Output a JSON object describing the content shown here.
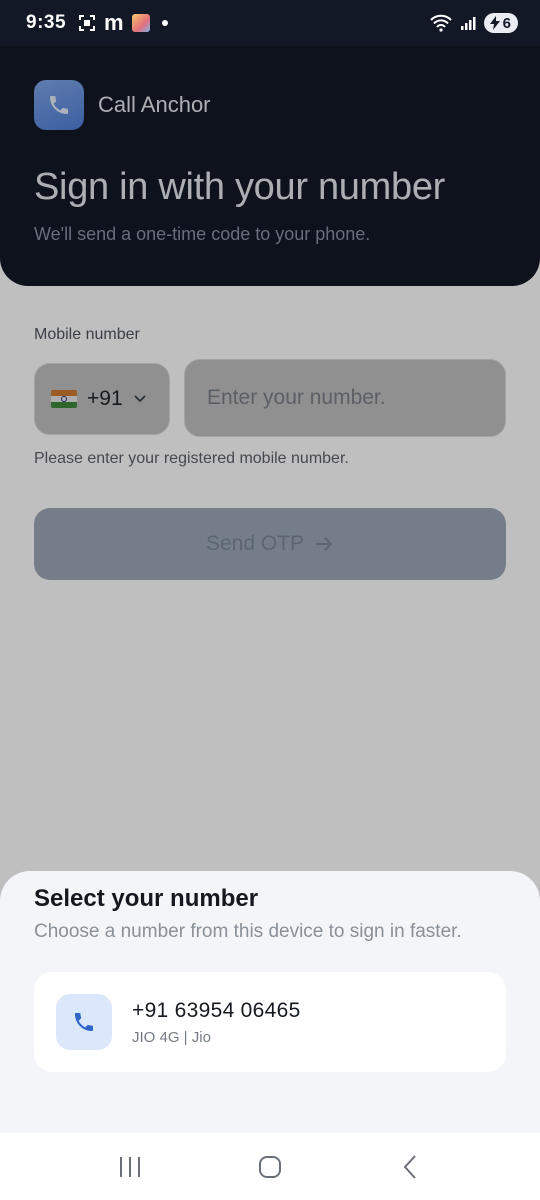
{
  "status_bar": {
    "time": "9:35",
    "left_icons": [
      "screenshot-icon",
      "m-app-icon",
      "app-thumbnail-icon",
      "notification-dot-icon"
    ],
    "m_glyph": "m",
    "right_icons": [
      "wifi-icon",
      "signal-icon",
      "battery-icon"
    ],
    "battery_level": "6"
  },
  "header": {
    "app_name": "Call Anchor",
    "title": "Sign in with your number",
    "subtitle": "We'll send a one-time code to your phone."
  },
  "form": {
    "mobile_label": "Mobile number",
    "country_code": "+91",
    "phone_placeholder": "Enter your number.",
    "helper_text": "Please enter your registered mobile number.",
    "send_otp_label": "Send OTP"
  },
  "sheet": {
    "title": "Select your number",
    "subtitle": "Choose a number from this device to sign in faster.",
    "numbers": [
      {
        "number": "+91 63954 06465",
        "carrier": "JIO 4G | Jio"
      }
    ]
  },
  "nav_bar": {
    "buttons": [
      "recents-icon",
      "home-icon",
      "back-icon"
    ]
  },
  "colors": {
    "header_bg": "#121826",
    "accent_blue": "#4f7fd8",
    "sheet_bg": "#f3f5f8",
    "button_disabled": "#9ca8b6"
  }
}
